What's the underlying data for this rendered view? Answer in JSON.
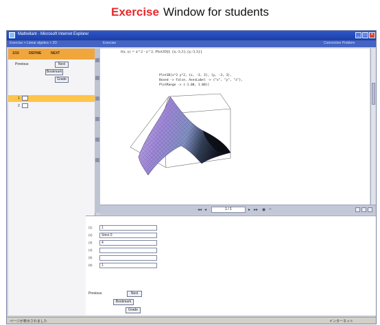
{
  "heading": {
    "highlight": "Exercise",
    "rest": "Window for students"
  },
  "window": {
    "title": "Mathellant - Microsoft Internet Explorer",
    "menu_left": "Exercise > Linear algebra > 2D",
    "menu_mid": "Exercise",
    "menu_right": "Connection Problem"
  },
  "left_pane": {
    "header": [
      "1/15",
      "DEFINE",
      "NEXT"
    ],
    "previous_label": "Previous",
    "buttons": {
      "next": "Next",
      "bookmark": "Bookmark",
      "grade": "Grade"
    },
    "tree": [
      "1",
      "2"
    ]
  },
  "content": {
    "formula": "f(x, y) = x^2 - y^2, Plot3D[f, {x,-3,3},{y,-3,3}]",
    "code_lines": [
      "Plot3D[x^2 y^2, {x, -3, 3}, {y, -3, 3},",
      "  Boxed -> False, AxesLabel -> {\"x\", \"y\", \"z\"},",
      "  PlotRange -> {-1.00, 1.00}]"
    ]
  },
  "plot_bar": {
    "page": "1 / 1"
  },
  "answers": {
    "numbers": [
      "(1)",
      "(2)",
      "(3)",
      "(4)",
      "(5)",
      "(6)"
    ],
    "values": [
      "1",
      "Strict 0",
      "4",
      "",
      "",
      "1"
    ],
    "previous_label": "Previous",
    "buttons": {
      "next": "Next",
      "bookmark": "Bookmark",
      "grade": "Grade"
    }
  },
  "status": {
    "left": "ページが表示されました",
    "right": "インターネット"
  },
  "colors": {
    "accent_red": "#e8282a",
    "titlebar": "#2f57c8",
    "left_header": "#f0a63c"
  }
}
